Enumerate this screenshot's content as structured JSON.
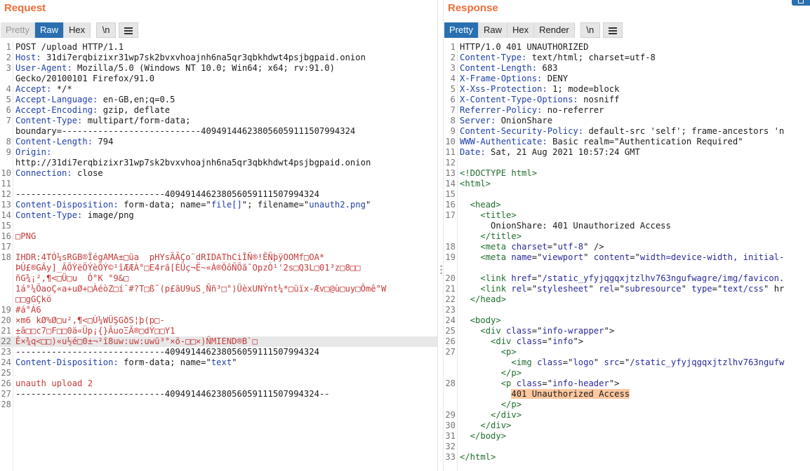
{
  "request": {
    "title": "Request",
    "tabs": [
      "Pretty",
      "Raw",
      "Hex"
    ],
    "newline_label": "\\n",
    "lines": [
      {
        "n": "1",
        "t": "POST /upload HTTP/1.1",
        "k": ""
      },
      {
        "n": "2",
        "k": "Host:",
        "t": " 31di7erqbizixr31wp7sk2bvxvhoajnh6na5qr3qbkhdwt4psjbgpaid.onion"
      },
      {
        "n": "3",
        "k": "User-Agent:",
        "t": " Mozilla/5.0 (Windows NT 10.0; Win64; x64; rv:91.0)"
      },
      {
        "n": "",
        "t": "Gecko/20100101 Firefox/91.0",
        "k": ""
      },
      {
        "n": "4",
        "k": "Accept:",
        "t": " */*"
      },
      {
        "n": "5",
        "k": "Accept-Language:",
        "t": " en-GB,en;q=0.5"
      },
      {
        "n": "6",
        "k": "Accept-Encoding:",
        "t": " gzip, deflate"
      },
      {
        "n": "7",
        "k": "Content-Type:",
        "t": " multipart/form-data;"
      },
      {
        "n": "",
        "t": "boundary=---------------------------409491446238056059111507994324",
        "k": ""
      },
      {
        "n": "8",
        "k": "Content-Length:",
        "t": " 794"
      },
      {
        "n": "9",
        "k": "Origin:",
        "t": ""
      },
      {
        "n": "",
        "t": "http://31di7erqbizixr31wp7sk2bvxvhoajnh6na5qr3qbkhdwt4psjbgpaid.onion",
        "k": ""
      },
      {
        "n": "10",
        "k": "Connection:",
        "t": " close"
      },
      {
        "n": "11",
        "t": "",
        "k": ""
      },
      {
        "n": "12",
        "t": "-----------------------------409491446238056059111507994324",
        "k": ""
      },
      {
        "n": "13",
        "k": "Content-Disposition:",
        "t": " form-data; name=\"",
        "q": "file[]",
        "t2": "\"; filename=\"",
        "q2": "unauth2.png",
        "t3": "\""
      },
      {
        "n": "14",
        "k": "Content-Type:",
        "t": " image/png"
      },
      {
        "n": "15",
        "t": "",
        "k": ""
      },
      {
        "n": "16",
        "r": "□PNG"
      },
      {
        "n": "17",
        "t": "",
        "k": ""
      },
      {
        "n": "18",
        "r": "IHDR:4TÓ¼sRGB®ÎégAMA±□üa  pHYsÃÃÇo¨dRIDATh­CiÎÑ®!ËÑþÿOOMf□OA*"
      },
      {
        "n": "",
        "r": "ÞÚ£®GÂy]_ÂÕÝëÕÝèÕÝ©¹îÆÆÀ°□E4rã[ÈÜç¬Ë~«À®ÖôÑÕã¯OpzÒ¹'2s□Q3L□01³z□8□□"
      },
      {
        "n": "",
        "r": "ñG¾¡²,¶<□Ü□u  Ó°K °9&□"
      },
      {
        "n": "",
        "r": "1á°¼ÕaoÇ«a+uØ+□ÀéòZ□í¯#?T□ß¯(p£ãU9uS¸Ññ³□°)ÜèxUNÝnt¼*□üïx-Æv□@ù□uy□Õmê°W"
      },
      {
        "n": "",
        "r": "□□gGÇkö"
      },
      {
        "n": "19",
        "r": "#á°Á6"
      },
      {
        "n": "20",
        "r": "×m6 kØ%Ø□u²,¶<□Ù¼WÜŞGðS¦þ(p□-"
      },
      {
        "n": "21",
        "r": "±â□□c7□F□□0ä«Üp¡{}ÂuoΞÃ®□dÝ□□Y1"
      },
      {
        "n": "22",
        "r": "Ê×¾q<□□)«u½é□0±¬²î8uw:uw:uwü³°×õ-□□×)ÑMIEND®B`□",
        "hl": true
      },
      {
        "n": "23",
        "t": "-----------------------------409491446238056059111507994324",
        "k": ""
      },
      {
        "n": "24",
        "k": "Content-Disposition:",
        "t": " form-data; name=\"",
        "q": "text",
        "t2": "\""
      },
      {
        "n": "25",
        "t": "",
        "k": ""
      },
      {
        "n": "26",
        "r": "unauth upload 2"
      },
      {
        "n": "27",
        "t": "-----------------------------409491446238056059111507994324--",
        "k": ""
      },
      {
        "n": "28",
        "t": "",
        "k": ""
      }
    ]
  },
  "response": {
    "title": "Response",
    "tabs": [
      "Pretty",
      "Raw",
      "Hex",
      "Render"
    ],
    "newline_label": "\\n",
    "lines": [
      {
        "n": "1",
        "t": "HTTP/1.0 401 UNAUTHORIZED",
        "k": ""
      },
      {
        "n": "2",
        "k": "Content-Type:",
        "t": " text/html; charset=utf-8"
      },
      {
        "n": "3",
        "k": "Content-Length:",
        "t": " 683"
      },
      {
        "n": "4",
        "k": "X-Frame-Options:",
        "t": " DENY"
      },
      {
        "n": "5",
        "k": "X-Xss-Protection:",
        "t": " 1; mode=block"
      },
      {
        "n": "6",
        "k": "X-Content-Type-Options:",
        "t": " nosniff"
      },
      {
        "n": "7",
        "k": "Referrer-Policy:",
        "t": " no-referrer"
      },
      {
        "n": "8",
        "k": "Server:",
        "t": " OnionShare"
      },
      {
        "n": "9",
        "k": "Content-Security-Policy:",
        "t": " default-src 'self'; frame-ancestors 'n"
      },
      {
        "n": "10",
        "k": "WWW-Authenticate:",
        "t": " Basic realm=\"Authentication Required\""
      },
      {
        "n": "11",
        "k": "Date:",
        "t": " Sat, 21 Aug 2021 10:57:24 GMT"
      },
      {
        "n": "12",
        "t": "",
        "k": ""
      },
      {
        "n": "13",
        "g": "<!DOCTYPE html>"
      },
      {
        "n": "14",
        "g": "<html>"
      },
      {
        "n": "15",
        "t": "",
        "k": ""
      },
      {
        "n": "16",
        "indent": "  ",
        "g": "<head>"
      },
      {
        "n": "17",
        "indent": "    ",
        "g": "<title>"
      },
      {
        "n": "",
        "t": "      OnionShare: 401 Unauthorized Access",
        "k": ""
      },
      {
        "n": "",
        "indent": "    ",
        "g": "</title>"
      },
      {
        "n": "18",
        "indent": "    ",
        "g": "<meta ",
        "a": "charset",
        "eq": "=\"",
        "v": "utf-8",
        "end": "\" />"
      },
      {
        "n": "19",
        "indent": "    ",
        "g": "<meta ",
        "a": "name",
        "eq": "=\"",
        "v": "viewport",
        "mid": "\" ",
        "a2": "content",
        "eq2": "=\"",
        "v2": "width=device-width, initial-"
      },
      {
        "n": "",
        "t": "",
        "k": ""
      },
      {
        "n": "20",
        "indent": "    ",
        "g": "<link ",
        "a": "href",
        "eq": "=\"",
        "v": "/static_yfyjqgqxjtzlhv763ngufwagre/img/favicon."
      },
      {
        "n": "21",
        "indent": "    ",
        "g": "<link ",
        "a": "rel",
        "eq": "=\"",
        "v": "stylesheet",
        "mid": "\" ",
        "a2": "rel",
        "eq2": "=\"",
        "v2": "subresource",
        "mid2": "\" ",
        "a3": "type",
        "eq3": "=\"",
        "v3": "text/css",
        "end": "\" hr"
      },
      {
        "n": "22",
        "indent": "  ",
        "g": "</head>"
      },
      {
        "n": "23",
        "t": "",
        "k": ""
      },
      {
        "n": "24",
        "indent": "  ",
        "g": "<body>"
      },
      {
        "n": "25",
        "indent": "    ",
        "g": "<div ",
        "a": "class",
        "eq": "=\"",
        "v": "info-wrapper",
        "end": "\">"
      },
      {
        "n": "26",
        "indent": "      ",
        "g": "<div ",
        "a": "class",
        "eq": "=\"",
        "v": "info",
        "end": "\">"
      },
      {
        "n": "27",
        "indent": "        ",
        "g": "<p>"
      },
      {
        "n": "",
        "indent": "          ",
        "g": "<img ",
        "a": "class",
        "eq": "=\"",
        "v": "logo",
        "mid": "\" ",
        "a2": "src",
        "eq2": "=\"",
        "v2": "/static_yfyjqgqxjtzlhv763ngufw"
      },
      {
        "n": "",
        "indent": "        ",
        "g": "</p>"
      },
      {
        "n": "28",
        "indent": "        ",
        "g": "<p ",
        "a": "class",
        "eq": "=\"",
        "v": "info-header",
        "end": "\">"
      },
      {
        "n": "",
        "indent": "          ",
        "mk": "401 Unauthorized Access"
      },
      {
        "n": "",
        "indent": "        ",
        "g": "</p>"
      },
      {
        "n": "29",
        "indent": "      ",
        "g": "</div>"
      },
      {
        "n": "30",
        "indent": "    ",
        "g": "</div>"
      },
      {
        "n": "31",
        "indent": "  ",
        "g": "</body>"
      },
      {
        "n": "32",
        "t": "",
        "k": ""
      },
      {
        "n": "33",
        "g": "</html>"
      }
    ]
  },
  "colors": {
    "accent_title": "#ef6e38",
    "active_tab": "#2a6fb0",
    "header_key": "#1f3fa8",
    "binary_text": "#c53b3b",
    "html_tag": "#1f6e2e",
    "highlight": "#ffc8a0"
  },
  "icons": {
    "menu": "hamburger-menu-icon",
    "panel_corner": "layout-icon"
  }
}
